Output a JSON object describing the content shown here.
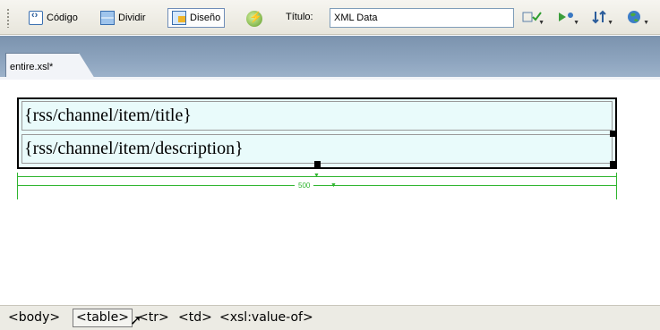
{
  "toolbar": {
    "views": [
      {
        "label": "Código",
        "icon": "code-view-icon"
      },
      {
        "label": "Dividir",
        "icon": "split-view-icon"
      },
      {
        "label": "Diseño",
        "icon": "design-view-icon"
      }
    ],
    "title_label": "Título:",
    "title_value": "XML Data",
    "tools": [
      {
        "icon": "validate-icon"
      },
      {
        "icon": "live-preview-icon"
      },
      {
        "icon": "refresh-arrows-icon"
      },
      {
        "icon": "browser-globe-icon"
      }
    ]
  },
  "tabs": {
    "active": "entire.xsl*"
  },
  "design": {
    "cells": [
      "{rss/channel/item/title}",
      "{rss/channel/item/description}"
    ],
    "table_width": "500",
    "cell_bg": "#e9fbfb",
    "guide_color": "#2fb52f"
  },
  "status": {
    "tags": [
      "<body>",
      "<table>",
      "<tr>",
      "<td>",
      "<xsl:value-of>"
    ]
  }
}
